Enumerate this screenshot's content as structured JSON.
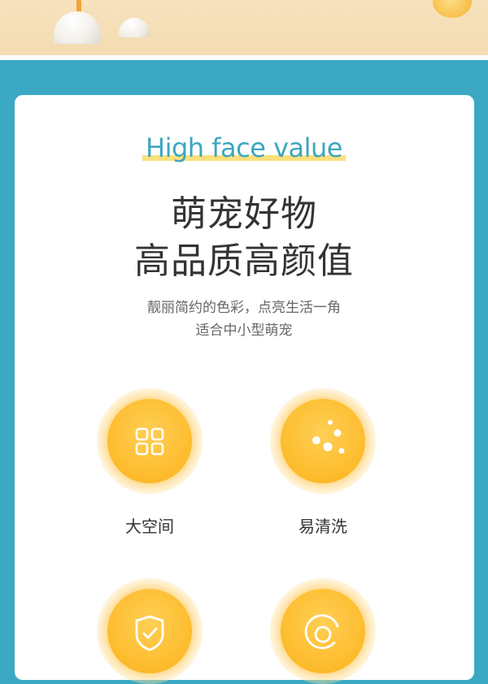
{
  "header": {
    "english_title": "High face value",
    "title_line1": "萌宠好物",
    "title_line2": "高品质高颜值"
  },
  "description": {
    "line1": "靓丽简约的色彩，点亮生活一角",
    "line2": "适合中小型萌宠"
  },
  "features": [
    {
      "label": "大空间",
      "icon": "grid-icon"
    },
    {
      "label": "易清洗",
      "icon": "bubbles-icon"
    },
    {
      "label": "",
      "icon": "shield-check-icon"
    },
    {
      "label": "",
      "icon": "ring-icon"
    }
  ],
  "colors": {
    "background": "#3ba9c3",
    "accent_title": "#3da6be",
    "highlight": "#fbe07c",
    "feature_circle": "#fdbb2c"
  }
}
